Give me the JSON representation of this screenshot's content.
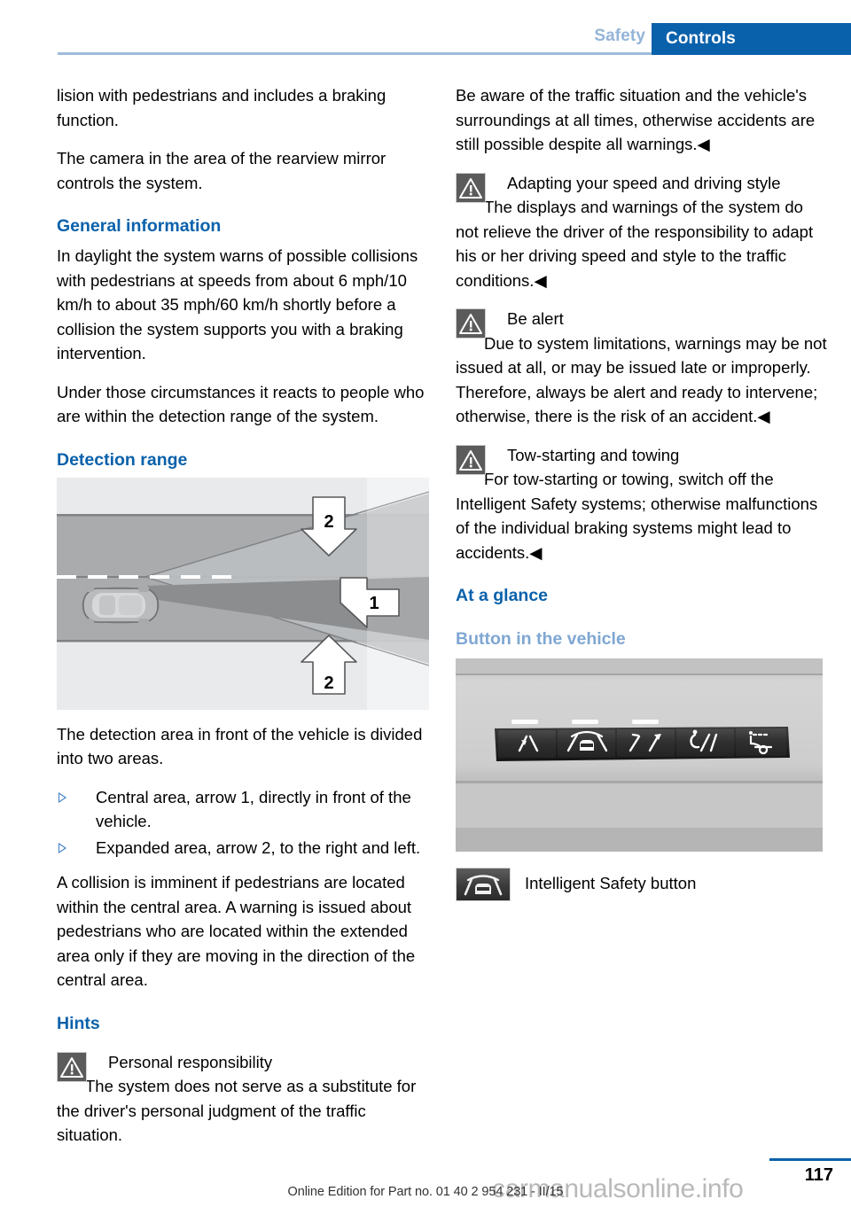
{
  "header": {
    "chapter": "Safety",
    "tab": "Controls"
  },
  "left_column": {
    "intro_1": "lision with pedestrians and includes a braking function.",
    "intro_2": "The camera in the area of the rearview mirror controls the system.",
    "general_information_heading": "General information",
    "general_p1": "In daylight the system warns of possible collisions with pedestrians at speeds from about 6 mph/10 km/h to about 35 mph/60 km/h shortly before a collision the system supports you with a braking intervention.",
    "general_p2": "Under those circumstances it reacts to people who are within the detection range of the system.",
    "detection_range_heading": "Detection range",
    "detection_caption": "The detection area in front of the vehicle is divided into two areas.",
    "bullets": [
      "Central area, arrow 1, directly in front of the vehicle.",
      "Expanded area, arrow 2, to the right and left."
    ],
    "collision_p": "A collision is imminent if pedestrians are located within the central area. A warning is issued about pedestrians who are located within the extended area only if they are moving in the direction of the central area.",
    "hints_heading": "Hints",
    "hint_warning": {
      "icon": "warning-triangle-icon",
      "title": "Personal responsibility",
      "body": "The system does not serve as a substitute for the driver's personal judgment of the traffic situation."
    }
  },
  "right_column": {
    "awareness_p": "Be aware of the traffic situation and the vehicle's surroundings at all times, otherwise accidents are still possible despite all warnings.◀",
    "warnings": [
      {
        "icon": "warning-triangle-icon",
        "title": "Adapting your speed and driving style",
        "body": "The displays and warnings of the system do not relieve the driver of the responsibility to adapt his or her driving speed and style to the traffic conditions.◀"
      },
      {
        "icon": "warning-triangle-icon",
        "title": "Be alert",
        "body": "Due to system limitations, warnings may be not issued at all, or may be issued late or improperly. Therefore, always be alert and ready to intervene; otherwise, there is the risk of an accident.◀"
      },
      {
        "icon": "warning-triangle-icon",
        "title": "Tow-starting and towing",
        "body": "For tow-starting or towing, switch off the Intelligent Safety systems; otherwise malfunctions of the individual braking systems might lead to accidents.◀"
      }
    ],
    "at_a_glance_heading": "At a glance",
    "button_in_vehicle_heading": "Button in the vehicle",
    "legend": {
      "icon": "intelligent-safety-button-icon",
      "label": "Intelligent Safety button"
    }
  },
  "figure_detection": {
    "name": "detection-range-diagram",
    "arrow_labels": [
      "2",
      "1",
      "2"
    ],
    "colors": {
      "background": "#e9eaec",
      "road": "#a9abad",
      "central_cone": "#8b8d8f",
      "expanded_cone": "#bcbec0",
      "lane_marking": "#ffffff",
      "arrow_fill": "#ffffff",
      "arrow_stroke": "#58595b"
    }
  },
  "figure_button_panel": {
    "name": "intelligent-safety-button-panel-photo",
    "buttons": [
      "lane-departure-warning-icon",
      "intelligent-safety-icon",
      "lane-change-warning-icon",
      "pedestrian-warning-icon",
      "head-up-display-icon"
    ],
    "colors": {
      "trim": "#c6c6c6",
      "button": "#2e2e2e",
      "icon": "#ffffff"
    }
  },
  "footer": {
    "page_number": "117",
    "note": "Online Edition for Part no. 01 40 2 954 231 - II/15",
    "watermark": "carmanualsonline.info"
  },
  "theme": {
    "accent_blue": "#0a61ab",
    "light_blue": "#7fa7d2",
    "chapter_blue": "#94b4d8"
  }
}
